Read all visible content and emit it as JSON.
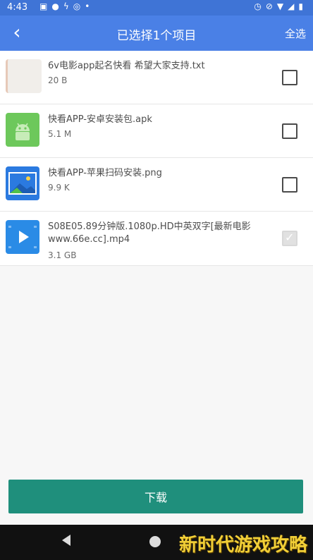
{
  "status_bar": {
    "time": "4:43",
    "left_icons": [
      "image-icon",
      "chat-icon",
      "bolt-icon",
      "location-icon",
      "dot-icon"
    ],
    "right_icons": [
      "alarm-icon",
      "no-sound-icon",
      "wifi-icon",
      "signal-icon",
      "battery-icon"
    ]
  },
  "app_bar": {
    "back_glyph": "‹",
    "title": "已选择1个项目",
    "select_all": "全选"
  },
  "files": [
    {
      "name": "6v电影app起名快看 希望大家支持.txt",
      "size": "20 B",
      "type": "txt",
      "checked": false
    },
    {
      "name": "快看APP-安卓安装包.apk",
      "size": "5.1 M",
      "type": "apk",
      "checked": false
    },
    {
      "name": "快看APP-苹果扫码安装.png",
      "size": "9.9 K",
      "type": "png",
      "checked": false
    },
    {
      "name": "S08E05.89分钟版.1080p.HD中英双字[最新电影www.66e.cc].mp4",
      "size": "3.1 GB",
      "type": "mp4",
      "checked": true
    }
  ],
  "download_button": "下载",
  "watermark": "新时代游戏攻略",
  "colors": {
    "app_bar": "#4a80e6",
    "status_bar": "#3f74d6",
    "download_button": "#1f8f7c",
    "watermark": "#f1cf37"
  }
}
